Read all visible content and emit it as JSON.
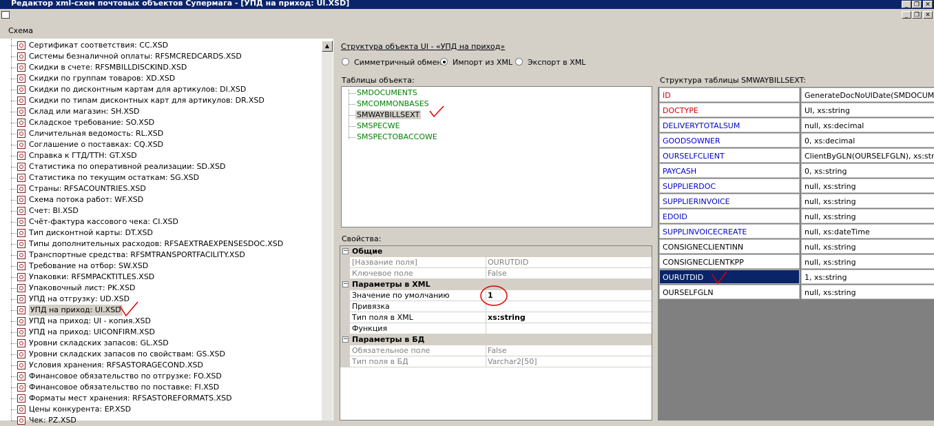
{
  "window": {
    "title": "Редактор xml-схем почтовых объектов Супермага - [УПД на приход: UI.XSD]"
  },
  "menu": {
    "items": [
      "Схема"
    ]
  },
  "tree": {
    "items": [
      "Сертификат соответствия: CC.XSD",
      "Системы безналичной оплаты: RFSMCREDCARDS.XSD",
      "Скидки в счете: RFSMBILLDISCKIND.XSD",
      "Скидки по группам товаров: XD.XSD",
      "Скидки по дисконтным картам для артикулов: DI.XSD",
      "Скидки по типам дисконтных карт для артикулов: DR.XSD",
      "Склад или магазин: SH.XSD",
      "Складское требование: SO.XSD",
      "Сличительная ведомость: RL.XSD",
      "Соглашение о поставках: CQ.XSD",
      "Справка к ГТД/ТТН: GT.XSD",
      "Статистика по оперативной реализации: SD.XSD",
      "Статистика по текущим остаткам: SG.XSD",
      "Страны: RFSACOUNTRIES.XSD",
      "Схема потока работ: WF.XSD",
      "Счет: BI.XSD",
      "Счёт-фактура кассового чека: CI.XSD",
      "Тип дисконтной карты: DT.XSD",
      "Типы дополнительных расходов: RFSAEXTRAEXPENSESDOC.XSD",
      "Транспортные средства: RFSMTRANSPORTFACILITY.XSD",
      "Требование на отбор: SW.XSD",
      "Упаковки: RFSMPACKTITLES.XSD",
      "Упаковочный лист: PK.XSD",
      "УПД на отгрузку: UD.XSD",
      "УПД на приход: UI.XSD",
      "УПД на приход: UI - копия.XSD",
      "УПД на приход: UICONFIRM.XSD",
      "Уровни складских запасов: GL.XSD",
      "Уровни складских запасов по свойствам: GS.XSD",
      "Условия хранения: RFSASTORAGECOND.XSD",
      "Финансовое обязательство по отгрузке: FO.XSD",
      "Финансовое обязательство по поставке: FI.XSD",
      "Форматы мест хранения: RFSASTOREFORMATS.XSD",
      "Цены конкурента: EP.XSD",
      "Чек: PZ.XSD"
    ],
    "selected_index": 24
  },
  "structure": {
    "link": "Структура объекта UI - «УПД на приход»",
    "radios": [
      {
        "label": "Симметричный обмен",
        "checked": false
      },
      {
        "label": "Импорт из XML",
        "checked": true
      },
      {
        "label": "Экспорт в XML",
        "checked": false
      }
    ],
    "tables_label": "Таблицы объекта:",
    "tables": [
      "SMDOCUMENTS",
      "SMCOMMONBASES",
      "SMWAYBILLSEXT",
      "SMSPECWE",
      "SMSPECTOBACCOWE"
    ],
    "selected_table_index": 2
  },
  "properties": {
    "label": "Свойства:",
    "rows": [
      {
        "type": "cat",
        "key": "Общие"
      },
      {
        "type": "prop",
        "key": "[Название поля]",
        "value": "OURUTDID",
        "disabled": true
      },
      {
        "type": "prop",
        "key": "Ключевое поле",
        "value": "False",
        "disabled": true
      },
      {
        "type": "cat",
        "key": "Параметры в XML"
      },
      {
        "type": "prop",
        "key": "Значение по умолчанию",
        "value": "1",
        "bold": true
      },
      {
        "type": "prop",
        "key": "Привязка",
        "value": ""
      },
      {
        "type": "prop",
        "key": "Тип поля в XML",
        "value": "xs:string",
        "bold": true
      },
      {
        "type": "prop",
        "key": "Функция",
        "value": ""
      },
      {
        "type": "cat",
        "key": "Параметры в БД"
      },
      {
        "type": "prop",
        "key": "Обязательное поле",
        "value": "False",
        "disabled": true
      },
      {
        "type": "prop",
        "key": "Тип поля в БД",
        "value": "Varchar2[50]",
        "disabled": true
      }
    ]
  },
  "grid": {
    "label": "Структура таблицы SMWAYBILLSEXT:",
    "rows": [
      {
        "field": "ID",
        "value": "GenerateDocNoUIDate(SMDOCUMENTS",
        "color": "red"
      },
      {
        "field": "DOCTYPE",
        "value": "UI, xs:string",
        "color": "red"
      },
      {
        "field": "DELIVERYTOTALSUM",
        "value": "null, xs:decimal",
        "color": "blue"
      },
      {
        "field": "GOODSOWNER",
        "value": "0, xs:decimal",
        "color": "blue"
      },
      {
        "field": "OURSELFCLIENT",
        "value": "ClientByGLN(OURSELFGLN), xs:string",
        "color": "blue"
      },
      {
        "field": "PAYCASH",
        "value": "0, xs:string",
        "color": "blue"
      },
      {
        "field": "SUPPLIERDOC",
        "value": "null, xs:string",
        "color": "blue"
      },
      {
        "field": "SUPPLIERINVOICE",
        "value": "null, xs:string",
        "color": "blue"
      },
      {
        "field": "EDOID",
        "value": "null, xs:string",
        "color": "blue"
      },
      {
        "field": "SUPPLINVOICECREATE",
        "value": "null, xs:dateTime",
        "color": "blue"
      },
      {
        "field": "CONSIGNECLIENTINN",
        "value": "null, xs:string",
        "color": "black"
      },
      {
        "field": "CONSIGNECLIENTKPP",
        "value": "null, xs:string",
        "color": "black"
      },
      {
        "field": "OURUTDID",
        "value": "1, xs:string",
        "color": "black"
      },
      {
        "field": "OURSELFGLN",
        "value": "null, xs:string",
        "color": "black"
      }
    ],
    "selected_index": 12
  },
  "colors": {
    "titlebar": "#0a246a",
    "selection": "#0a246a",
    "table_text": "#008000",
    "annotation": "#e00000"
  }
}
